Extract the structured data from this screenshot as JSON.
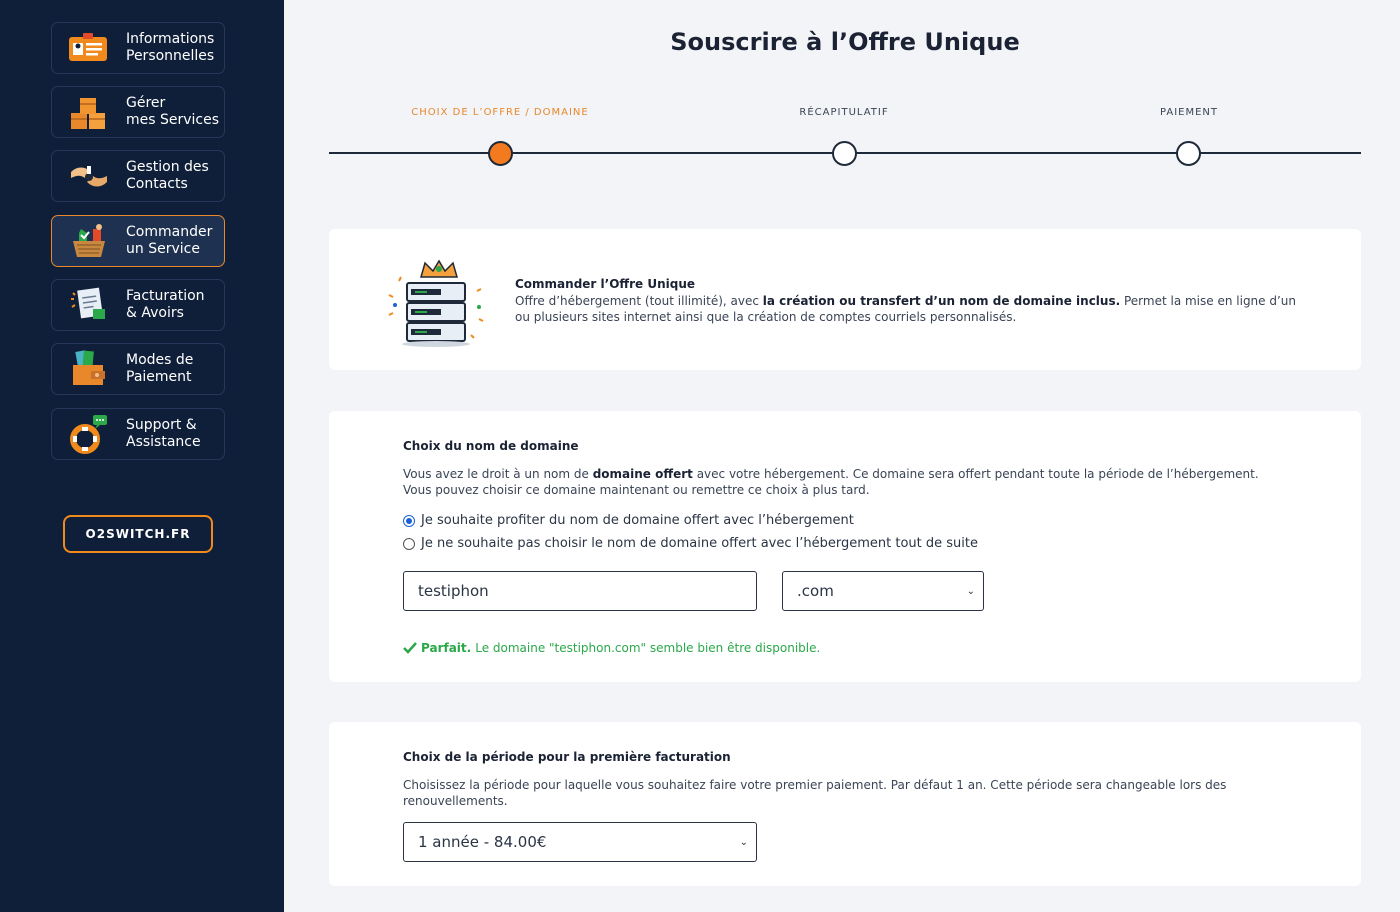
{
  "sidebar": {
    "items": [
      {
        "label": "Informations\nPersonnelles",
        "icon": "id-card-icon"
      },
      {
        "label": "Gérer\nmes Services",
        "icon": "boxes-icon"
      },
      {
        "label": "Gestion des\nContacts",
        "icon": "handshake-icon"
      },
      {
        "label": "Commander\nun Service",
        "icon": "shopping-basket-icon"
      },
      {
        "label": "Facturation\n& Avoirs",
        "icon": "invoice-icon"
      },
      {
        "label": "Modes de\nPaiement",
        "icon": "wallet-icon"
      },
      {
        "label": "Support &\nAssistance",
        "icon": "lifebuoy-icon"
      }
    ],
    "active_index": 3,
    "site_button": "O2SWITCH.FR"
  },
  "page_title": "Souscrire à l’Offre Unique",
  "steps": [
    {
      "label": "CHOIX DE L’OFFRE / DOMAINE",
      "active": true
    },
    {
      "label": "RÉCAPITULATIF",
      "active": false
    },
    {
      "label": "PAIEMENT",
      "active": false
    }
  ],
  "offer": {
    "title": "Commander l’Offre Unique",
    "desc_1": "Offre d’hébergement (tout illimité), avec ",
    "desc_bold": "la création ou transfert d’un nom de domaine inclus.",
    "desc_2": " Permet la mise en ligne d’un ou plusieurs sites internet ainsi que la création de comptes courriels personnalisés."
  },
  "domain": {
    "title": "Choix du nom de domaine",
    "desc_1": "Vous avez le droit à un nom de ",
    "desc_bold": "domaine offert",
    "desc_2": " avec votre hébergement. Ce domaine sera offert pendant toute la période de l’hébergement. Vous pouvez choisir ce domaine maintenant ou remettre ce choix à plus tard.",
    "option_yes": "Je souhaite profiter du nom de domaine offert avec l’hébergement",
    "option_no": "Je ne souhaite pas choisir le nom de domaine offert avec l’hébergement tout de suite",
    "name_value": "testiphon",
    "tld_value": ".com",
    "avail_bold": "Parfait.",
    "avail_text": "Le domaine \"testiphon.com\" semble bien être disponible.",
    "colors": {
      "success": "#2aa84a",
      "radio": "#1a63d6"
    }
  },
  "period": {
    "title": "Choix de la période pour la première facturation",
    "desc": "Choisissez la période pour laquelle vous souhaitez faire votre premier paiement. Par défaut 1 an. Cette période sera changeable lors des renouvellements.",
    "selected": "1 année - 84.00€"
  },
  "colors": {
    "accent": "#f47a1f",
    "sidebar_bg": "#0f1f3a",
    "page_bg": "#f3f4f8"
  }
}
